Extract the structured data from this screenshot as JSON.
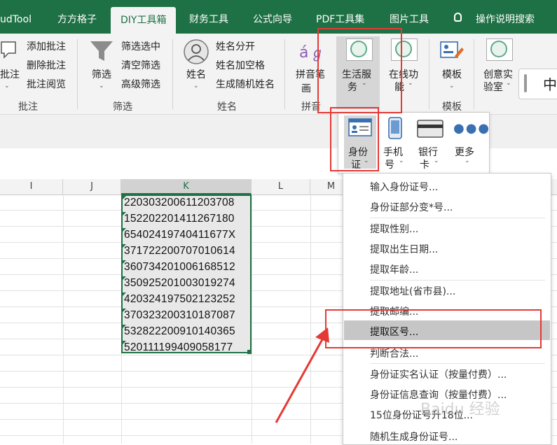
{
  "tabs": [
    "udTool",
    "方方格子",
    "DIY工具箱",
    "财务工具",
    "公式向导",
    "PDF工具集",
    "图片工具",
    "操作说明搜索"
  ],
  "ribbon": {
    "comment": {
      "big": "批注",
      "items": [
        "添加批注",
        "删除批注",
        "批注阅览"
      ],
      "group": "批注"
    },
    "filter": {
      "big": "筛选",
      "items": [
        "筛选选中",
        "清空筛选",
        "高级筛选"
      ],
      "group": "筛选"
    },
    "name": {
      "big": "姓名",
      "items": [
        "姓名分开",
        "姓名加空格",
        "生成随机姓名"
      ],
      "group": "姓名"
    },
    "pinyin": {
      "big_line1": "拼音笔",
      "big_line2": "画",
      "group": "拼音"
    },
    "life": {
      "line1": "生活服",
      "line2": "务"
    },
    "online": {
      "line1": "在线功",
      "line2": "能"
    },
    "template": {
      "big": "模板",
      "group": "模板"
    },
    "creative": {
      "line1": "创意实",
      "line2": "验室"
    },
    "ime": "中"
  },
  "gallery": [
    {
      "line1": "身份",
      "line2": "证"
    },
    {
      "line1": "手机",
      "line2": "号"
    },
    {
      "line1": "银行",
      "line2": "卡"
    },
    {
      "line1": "更多",
      "line2": ""
    }
  ],
  "columns": [
    "I",
    "J",
    "K",
    "L",
    "M"
  ],
  "cells": [
    "220303200611203708",
    "152202201411267180",
    "65402419740411677X",
    "371722200707010614",
    "360734201006168512",
    "350925201003019274",
    "420324197502123252",
    "370323200310187087",
    "532822200910140365",
    "520111199409058177"
  ],
  "menu": [
    "输入身份证号...",
    "身份证部分变*号...",
    "提取性别...",
    "提取出生日期...",
    "提取年龄...",
    "提取地址(省市县)...",
    "提取邮编...",
    "提取区号...",
    "判断合法...",
    "身份证实名认证（按量付费）...",
    "身份证信息查询（按量付费）...",
    "15位身份证号升18位...",
    "随机生成身份证号..."
  ],
  "highlighted_menu_item": "提取区号...",
  "watermark": "Baidu 经验",
  "colors": {
    "excel_green": "#1e7145",
    "annotation_red": "#e53935"
  }
}
